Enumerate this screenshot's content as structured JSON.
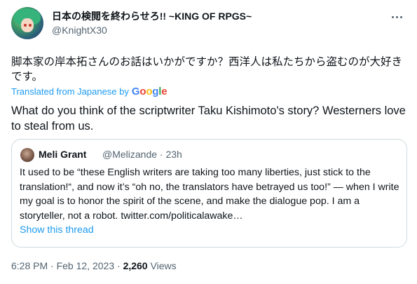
{
  "author": {
    "display_name": "日本の検閲を終わらせろ!! ~KING OF RPGS~",
    "handle": "@KnightX30"
  },
  "tweet": {
    "original_text": "脚本家の岸本拓さんのお話はいかがですか？西洋人は私たちから盗むのが大好きです。",
    "translated_from": "Translated from Japanese by",
    "translator_brand": [
      "G",
      "o",
      "o",
      "g",
      "l",
      "e"
    ],
    "translated_text": "What do you think of the scriptwriter Taku Kishimoto's story? Westerners love to steal from us."
  },
  "quote": {
    "name": "Meli Grant",
    "handle": "@Melizande",
    "separator": "·",
    "age": "23h",
    "body": "It used to be “these English writers are taking too many liberties, just stick to the translation!“, and now it’s “oh no, the translators have betrayed us too!” — when I write my goal is to honor the spirit of the scene, and make the dialogue pop. I am a storyteller, not a robot. twitter.com/politicalawake…",
    "show_thread": "Show this thread"
  },
  "footer": {
    "time": "6:28 PM",
    "separator": "·",
    "date": "Feb 12, 2023",
    "views_count": "2,260",
    "views_label": "Views"
  },
  "colors": {
    "accent": "#1d9bf0",
    "text": "#0f1419",
    "secondary": "#536471",
    "border": "#cfd9de"
  },
  "icons": [
    "more-horizontal-icon"
  ]
}
